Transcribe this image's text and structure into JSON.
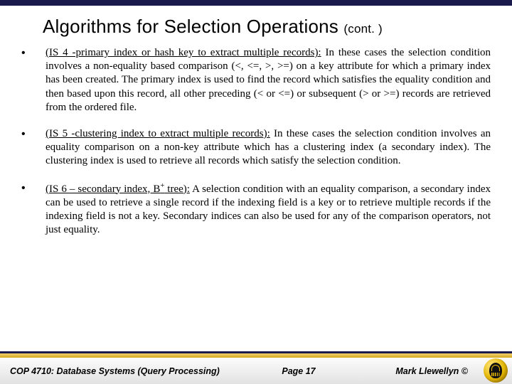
{
  "title_main": "Algorithms for Selection Operations ",
  "title_suffix": "(cont. )",
  "bullets": [
    {
      "head": "(IS 4 -primary index or hash key to extract multiple records):",
      "body": " In these cases the selection condition involves a non-equality based comparison (<, <=, >, >=) on a key attribute for which a primary index has been created.  The primary index is used to find the record which satisfies the equality condition and then based upon this record, all other preceding (< or <=) or subsequent (> or >=) records are retrieved from the ordered file."
    },
    {
      "head": "(IS 5 -clustering index to extract multiple records):",
      "body": "  In these cases the selection condition involves an equality comparison on a non-key attribute which has a clustering index (a secondary index).  The clustering index is used to retrieve all records which satisfy the selection condition."
    },
    {
      "head_pre": "(IS 6 – secondary index, B",
      "head_sup": "+",
      "head_post": " tree):",
      "body": "  A selection condition with an equality comparison, a secondary index can be used to retrieve a single record if the indexing field is a key or to retrieve multiple records if the indexing field is not a key.  Secondary indices can also be used for any of the comparison operators, not just equality."
    }
  ],
  "footer": {
    "left": "COP 4710: Database Systems (Query Processing)",
    "center": "Page 17",
    "right": "Mark Llewellyn ©"
  }
}
